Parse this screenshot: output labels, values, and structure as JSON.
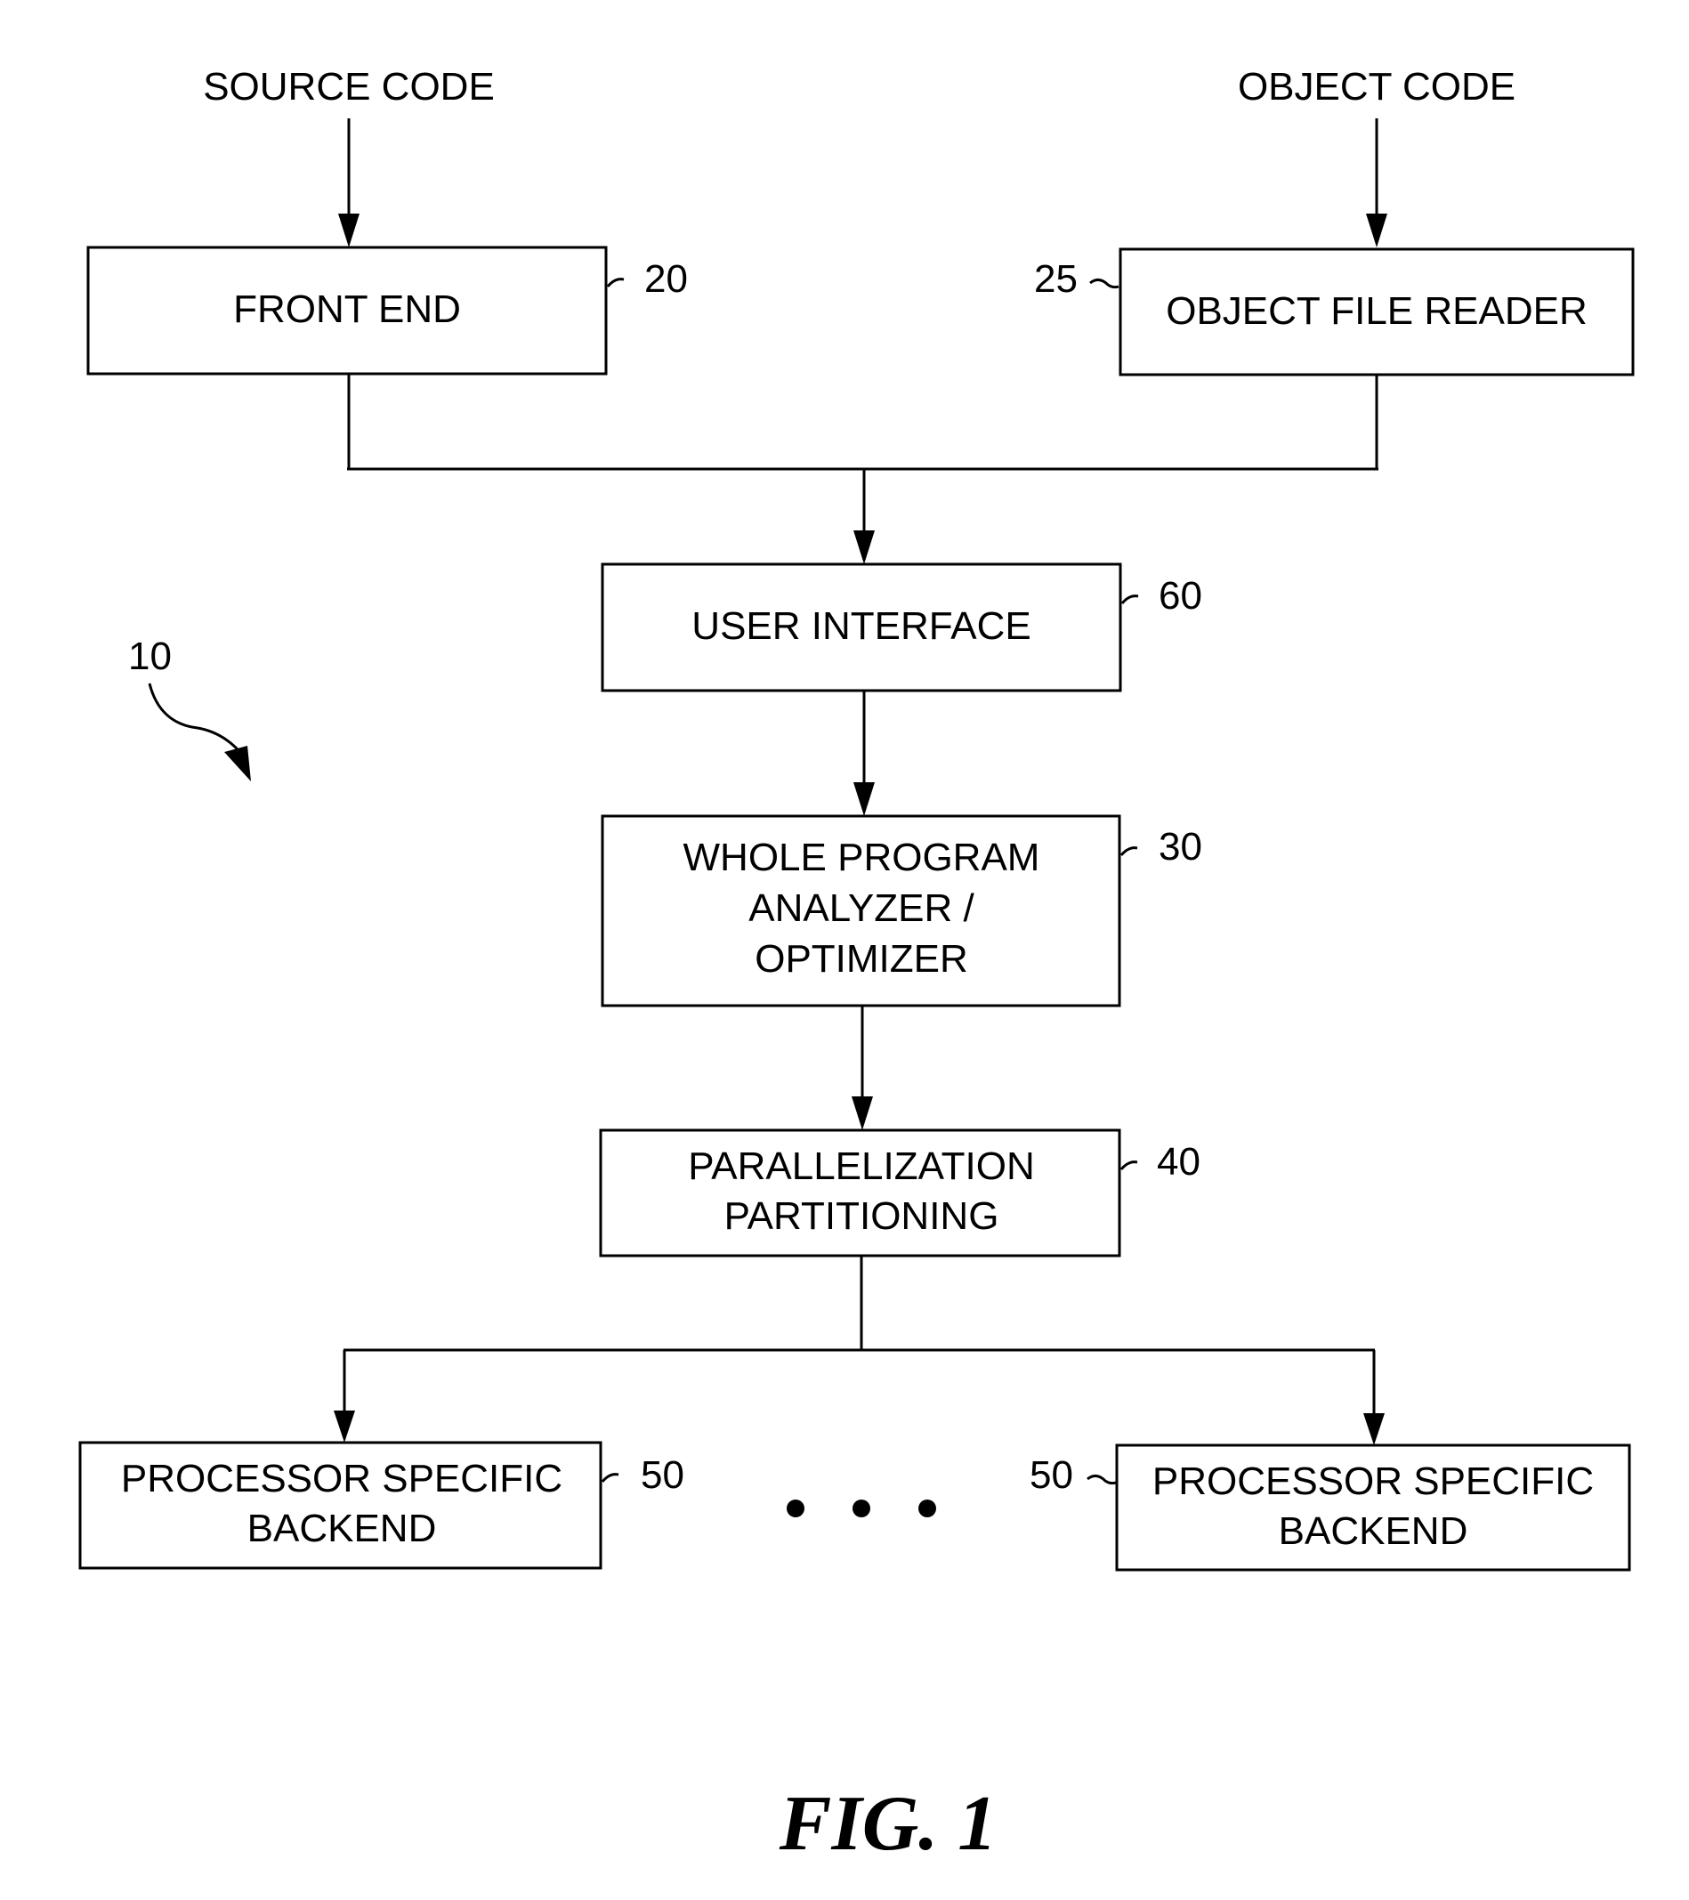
{
  "inputs": {
    "source_code": "SOURCE CODE",
    "object_code": "OBJECT CODE"
  },
  "blocks": {
    "front_end": {
      "label": "FRONT END",
      "ref": "20"
    },
    "object_file_reader": {
      "label": "OBJECT FILE READER",
      "ref": "25"
    },
    "user_interface": {
      "label": "USER INTERFACE",
      "ref": "60"
    },
    "whole_program": {
      "lines": [
        "WHOLE PROGRAM",
        "ANALYZER /",
        "OPTIMIZER"
      ],
      "ref": "30"
    },
    "parallelization": {
      "lines": [
        "PARALLELIZATION",
        "PARTITIONING"
      ],
      "ref": "40"
    },
    "backend_left": {
      "lines": [
        "PROCESSOR SPECIFIC",
        "BACKEND"
      ],
      "ref": "50"
    },
    "backend_right": {
      "lines": [
        "PROCESSOR SPECIFIC",
        "BACKEND"
      ],
      "ref": "50"
    }
  },
  "system_ref": "10",
  "ellipsis": "• • •",
  "figure_caption": "FIG. 1"
}
